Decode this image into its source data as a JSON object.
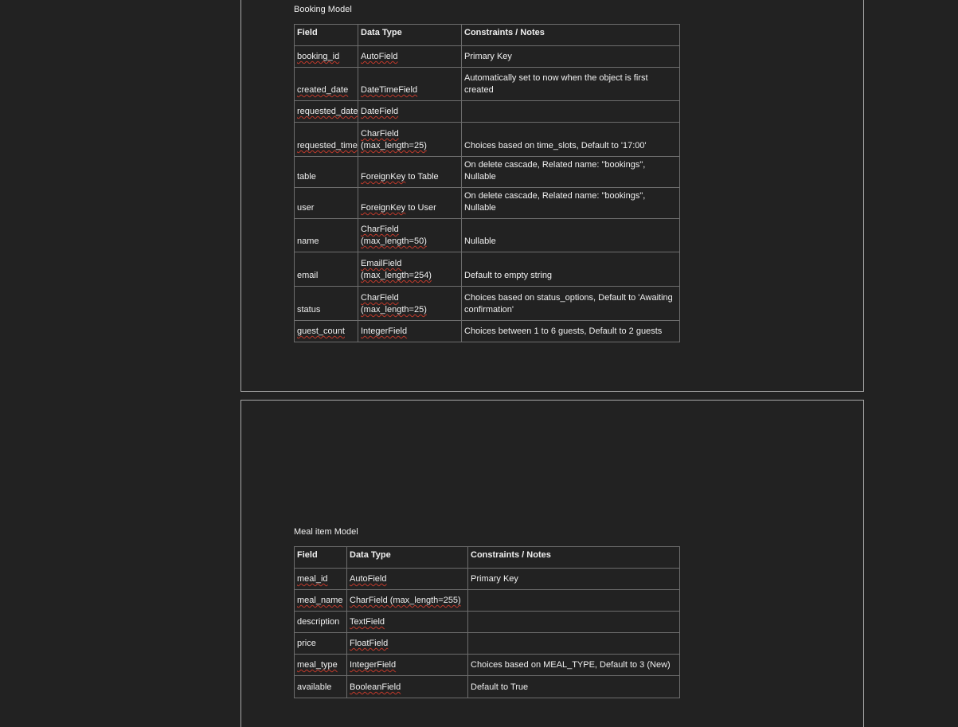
{
  "booking": {
    "title": "Booking Model",
    "headers": [
      "Field",
      "Data Type",
      "Constraints / Notes"
    ],
    "rows": [
      {
        "field": "booking_id",
        "type_1": "AutoField",
        "type_2": "",
        "notes_1": "Primary Key",
        "notes_2": ""
      },
      {
        "field": "created_date",
        "type_1": "DateTimeField",
        "type_2": "",
        "notes_1": "Automatically set to now when the object is first",
        "notes_2": "created"
      },
      {
        "field": "requested_date",
        "type_1": "DateField",
        "type_2": "",
        "notes_1": "",
        "notes_2": ""
      },
      {
        "field": "requested_time",
        "type_1": "CharField",
        "type_2": "(max_length=25)",
        "notes_1": "Choices based on time_slots, Default to '17:00'",
        "notes_2": ""
      },
      {
        "field": "table",
        "type_1": "ForeignKey to Table",
        "type_2": "",
        "notes_1": "On delete cascade, Related name: \"bookings\", Nullable",
        "notes_2": ""
      },
      {
        "field": "user",
        "type_1": "ForeignKey to User",
        "type_2": "",
        "notes_1": "On delete cascade, Related name: \"bookings\", Nullable",
        "notes_2": ""
      },
      {
        "field": "name",
        "type_1": "CharField",
        "type_2": "(max_length=50)",
        "notes_1": "Nullable",
        "notes_2": ""
      },
      {
        "field": "email",
        "type_1": "EmailField",
        "type_2": "(max_length=254)",
        "notes_1": "Default to empty string",
        "notes_2": ""
      },
      {
        "field": "status",
        "type_1": "CharField",
        "type_2": "(max_length=25)",
        "notes_1": "Choices based on status_options, Default to 'Awaiting",
        "notes_2": "confirmation'"
      },
      {
        "field": "guest_count",
        "type_1": "IntegerField",
        "type_2": "",
        "notes_1": "Choices between 1 to 6 guests, Default to 2 guests",
        "notes_2": ""
      }
    ]
  },
  "meal": {
    "title": "Meal item Model",
    "headers": [
      "Field",
      "Data Type",
      "Constraints / Notes"
    ],
    "rows": [
      {
        "field": "meal_id",
        "type": "AutoField",
        "notes": "Primary Key"
      },
      {
        "field": "meal_name",
        "type": "CharField (max_length=255)",
        "notes": ""
      },
      {
        "field": "description",
        "type": "TextField",
        "notes": ""
      },
      {
        "field": "price",
        "type": "FloatField",
        "notes": ""
      },
      {
        "field": "meal_type",
        "type": "IntegerField",
        "notes": "Choices based on MEAL_TYPE, Default to 3 (New)"
      },
      {
        "field": "available",
        "type": "BooleanField",
        "notes": "Default to True"
      }
    ]
  }
}
